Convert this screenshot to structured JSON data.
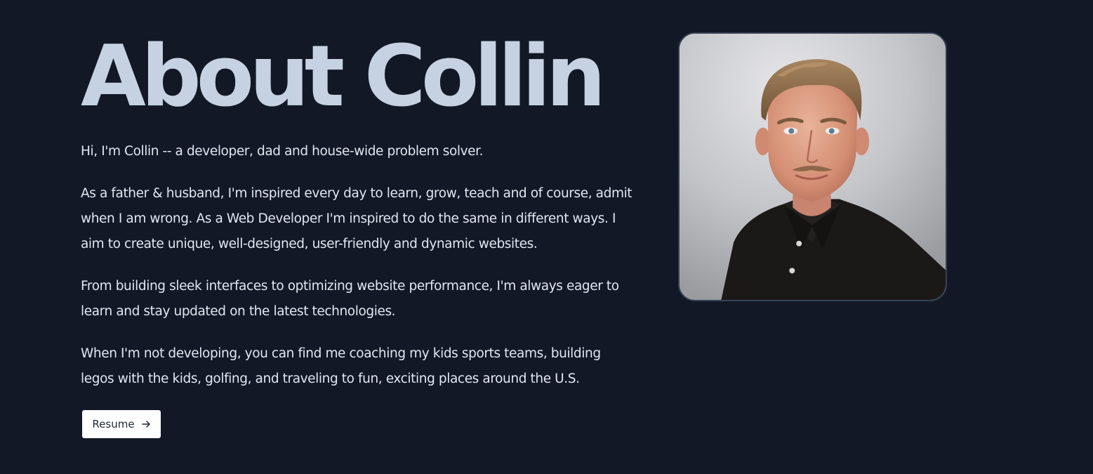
{
  "about": {
    "title": "About Collin",
    "paragraphs": [
      "Hi, I'm Collin -- a developer, dad and house-wide problem solver.",
      "As a father & husband, I'm inspired every day to learn, grow, teach and of course, admit when I am wrong. As a Web Developer I'm inspired to do the same in different ways. I aim to create unique, well-designed, user-friendly and dynamic websites.",
      "From building sleek interfaces to optimizing website performance, I'm always eager to learn and stay updated on the latest technologies.",
      "When I'm not developing, you can find me coaching my kids sports teams, building legos with the kids, golfing, and traveling to fun, exciting places around the U.S."
    ],
    "resume_button": {
      "label": "Resume",
      "icon": "arrow-right-icon"
    },
    "photo": {
      "subject": "portrait-photo"
    }
  },
  "colors": {
    "background": "#121826",
    "title": "#c6d2e1",
    "body_text": "#e2e8f0",
    "button_bg": "#ffffff",
    "button_text": "#1f2937",
    "photo_border": "#374151"
  }
}
